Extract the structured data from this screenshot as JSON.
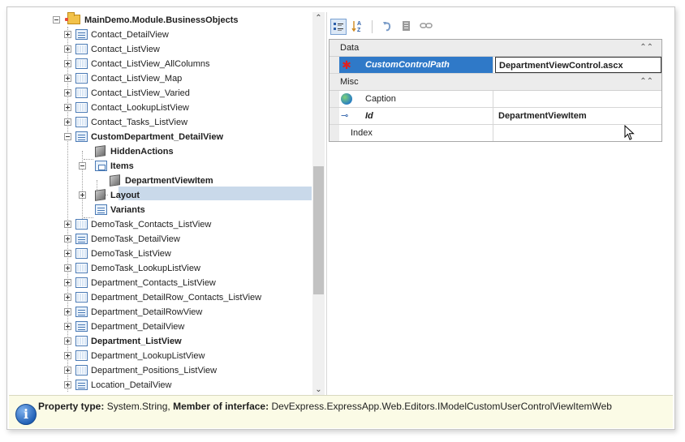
{
  "tree": {
    "items": [
      {
        "label": "MainDemo.Module.BusinessObjects",
        "bold": true,
        "icon": "folder-icon"
      },
      {
        "label": "Contact_DetailView",
        "icon": "detail-view-icon"
      },
      {
        "label": "Contact_ListView",
        "icon": "list-view-icon"
      },
      {
        "label": "Contact_ListView_AllColumns",
        "icon": "list-view-icon"
      },
      {
        "label": "Contact_ListView_Map",
        "icon": "list-view-icon"
      },
      {
        "label": "Contact_ListView_Varied",
        "icon": "list-view-icon"
      },
      {
        "label": "Contact_LookupListView",
        "icon": "list-view-icon"
      },
      {
        "label": "Contact_Tasks_ListView",
        "icon": "list-view-icon"
      },
      {
        "label": "CustomDepartment_DetailView",
        "bold": true,
        "icon": "detail-view-icon"
      },
      {
        "label": "HiddenActions",
        "bold": true,
        "icon": "cube-icon"
      },
      {
        "label": "Items",
        "bold": true,
        "icon": "items-icon"
      },
      {
        "label": "DepartmentViewItem",
        "bold": true,
        "icon": "cube-icon",
        "selected": true
      },
      {
        "label": "Layout",
        "bold": true,
        "icon": "cube-icon"
      },
      {
        "label": "Variants",
        "bold": true,
        "icon": "detail-view-icon"
      },
      {
        "label": "DemoTask_Contacts_ListView",
        "icon": "list-view-icon"
      },
      {
        "label": "DemoTask_DetailView",
        "icon": "detail-view-icon"
      },
      {
        "label": "DemoTask_ListView",
        "icon": "list-view-icon"
      },
      {
        "label": "DemoTask_LookupListView",
        "icon": "list-view-icon"
      },
      {
        "label": "Department_Contacts_ListView",
        "icon": "list-view-icon"
      },
      {
        "label": "Department_DetailRow_Contacts_ListView",
        "icon": "list-view-icon"
      },
      {
        "label": "Department_DetailRowView",
        "icon": "detail-view-icon"
      },
      {
        "label": "Department_DetailView",
        "icon": "detail-view-icon"
      },
      {
        "label": "Department_ListView",
        "bold": true,
        "icon": "list-view-icon"
      },
      {
        "label": "Department_LookupListView",
        "icon": "list-view-icon"
      },
      {
        "label": "Department_Positions_ListView",
        "icon": "list-view-icon"
      },
      {
        "label": "Location_DetailView",
        "icon": "detail-view-icon"
      }
    ]
  },
  "scrollbar": {
    "up": "⌃",
    "down": "⌄"
  },
  "toolbar": {
    "categorized": "categorized-icon",
    "alphabetical": "sort-az-icon",
    "undo": "undo-icon",
    "reset": "reset-icon",
    "link": "link-icon"
  },
  "grid": {
    "cat_data": "Data",
    "cat_misc": "Misc",
    "collapse": "⌃⌃",
    "rows": {
      "customcontrolpath": {
        "name": "CustomControlPath",
        "value": "DepartmentViewControl.ascx"
      },
      "caption": {
        "name": "Caption",
        "value": ""
      },
      "id": {
        "name": "Id",
        "value": "DepartmentViewItem"
      },
      "index": {
        "name": "Index",
        "value": ""
      }
    }
  },
  "status": {
    "property_type_label": "Property type:",
    "property_type_value": "System.String,",
    "member_label": "Member of interface:",
    "member_value": "DevExpress.ExpressApp.Web.Editors.IModelCustomUserControlViewItemWeb"
  },
  "colors": {
    "selection": "#2f79c8",
    "tree_selection": "#c9d9ea",
    "status_bg": "#fbfbe6"
  }
}
